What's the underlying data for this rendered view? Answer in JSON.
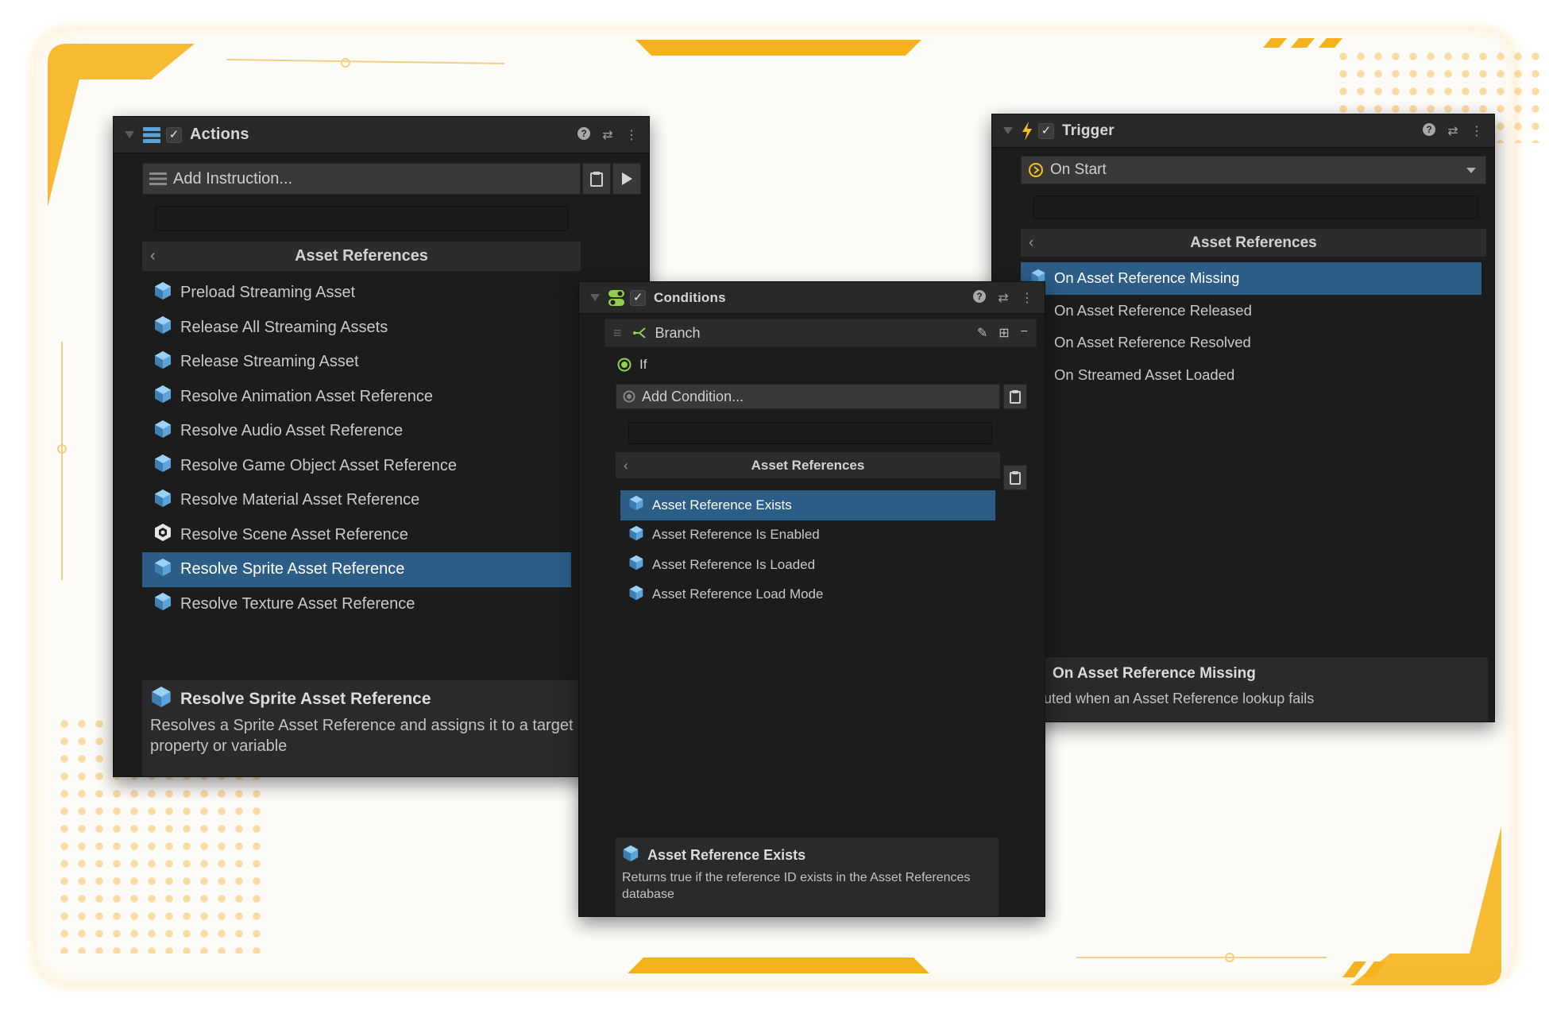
{
  "actions": {
    "title": "Actions",
    "add_placeholder": "Add Instruction...",
    "section_title": "Asset References",
    "back_glyph": "‹",
    "items": [
      {
        "label": "Preload Streaming Asset",
        "icon": "cube-icon",
        "selected": false
      },
      {
        "label": "Release All Streaming Assets",
        "icon": "cube-icon",
        "selected": false
      },
      {
        "label": "Release Streaming Asset",
        "icon": "cube-icon",
        "selected": false
      },
      {
        "label": "Resolve Animation Asset Reference",
        "icon": "cube-icon",
        "selected": false
      },
      {
        "label": "Resolve Audio Asset Reference",
        "icon": "cube-icon",
        "selected": false
      },
      {
        "label": "Resolve Game Object Asset Reference",
        "icon": "cube-icon",
        "selected": false
      },
      {
        "label": "Resolve Material Asset Reference",
        "icon": "cube-icon",
        "selected": false
      },
      {
        "label": "Resolve Scene Asset Reference",
        "icon": "unity-scene-icon",
        "selected": false
      },
      {
        "label": "Resolve Sprite Asset Reference",
        "icon": "cube-icon",
        "selected": true
      },
      {
        "label": "Resolve Texture Asset Reference",
        "icon": "cube-icon",
        "selected": false
      }
    ],
    "footer_title": "Resolve Sprite Asset Reference",
    "footer_desc": "Resolves a Sprite Asset Reference and assigns it to a target property or variable"
  },
  "conditions": {
    "title": "Conditions",
    "branch_label": "Branch",
    "if_label": "If",
    "add_placeholder": "Add Condition...",
    "section_title": "Asset References",
    "back_glyph": "‹",
    "items": [
      {
        "label": "Asset Reference Exists",
        "icon": "cube-icon",
        "selected": true
      },
      {
        "label": "Asset Reference Is Enabled",
        "icon": "cube-icon",
        "selected": false
      },
      {
        "label": "Asset Reference Is Loaded",
        "icon": "cube-icon",
        "selected": false
      },
      {
        "label": "Asset Reference Load Mode",
        "icon": "cube-icon",
        "selected": false
      }
    ],
    "footer_title": "Asset Reference Exists",
    "footer_desc": "Returns true if the reference ID exists in the Asset References database"
  },
  "trigger": {
    "title": "Trigger",
    "event_value": "On Start",
    "section_title": "Asset References",
    "back_glyph": "‹",
    "items": [
      {
        "label": "On Asset Reference Missing",
        "icon": "cube-icon",
        "selected": true
      },
      {
        "label": "On Asset Reference Released",
        "icon": "cube-icon",
        "selected": false
      },
      {
        "label": "On Asset Reference Resolved",
        "icon": "cube-icon",
        "selected": false
      },
      {
        "label": "On Streamed Asset Loaded",
        "icon": "cube-icon",
        "selected": false
      }
    ],
    "footer_title": "On Asset Reference Missing",
    "footer_desc": "ecuted when an Asset Reference lookup fails"
  },
  "colors": {
    "accent": "#f5b21d",
    "selection": "#2c5d87",
    "panel_bg": "#1c1c1c",
    "cube_icon": "#5ba3d9",
    "condition_icon": "#8fd14f",
    "trigger_icon": "#f5c020"
  }
}
